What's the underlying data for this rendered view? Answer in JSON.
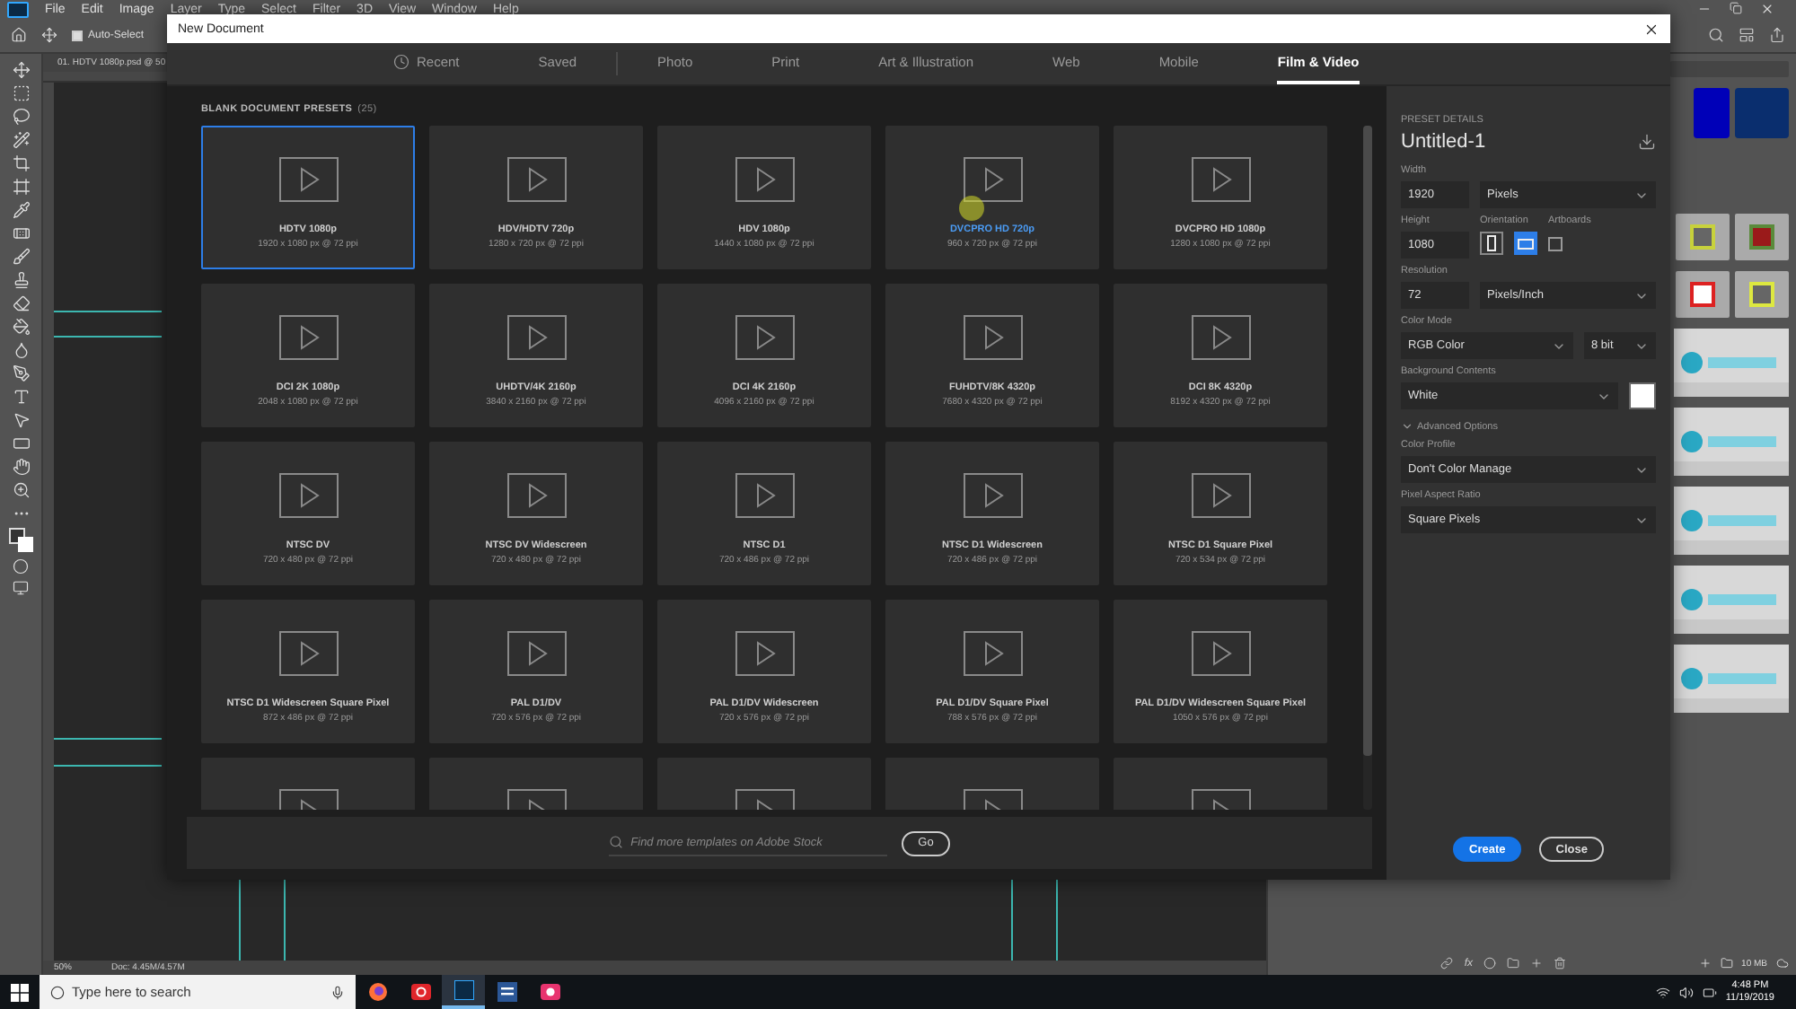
{
  "photoshop": {
    "menu": [
      "File",
      "Edit",
      "Image",
      "Layer",
      "Type",
      "Select",
      "Filter",
      "3D",
      "View",
      "Window",
      "Help"
    ],
    "options_bar": {
      "auto_select": {
        "label": "Auto-Select",
        "checked": true
      }
    },
    "document_tab": "01. HDTV 1080p.psd @ 50",
    "status_bar": {
      "zoom": "50%",
      "doc": "Doc: 4.45M/4.57M"
    },
    "layers_footer": {
      "fx": "fx"
    },
    "panel_footer": {
      "size": "10 MB"
    }
  },
  "dialog": {
    "title": "New Document",
    "tabs": [
      {
        "label": "Recent",
        "kind": "recent",
        "selected": false
      },
      {
        "label": "Saved",
        "kind": "saved",
        "selected": false
      },
      {
        "label": "Photo",
        "kind": "category",
        "selected": false
      },
      {
        "label": "Print",
        "kind": "category",
        "selected": false
      },
      {
        "label": "Art & Illustration",
        "kind": "category",
        "selected": false
      },
      {
        "label": "Web",
        "kind": "category",
        "selected": false
      },
      {
        "label": "Mobile",
        "kind": "category",
        "selected": false
      },
      {
        "label": "Film & Video",
        "kind": "category",
        "selected": true
      }
    ],
    "presets": {
      "heading": "BLANK DOCUMENT PRESETS",
      "count": "(25)",
      "items": [
        {
          "name": "HDTV 1080p",
          "size": "1920 x 1080 px @ 72 ppi",
          "selected": true,
          "hovered": false
        },
        {
          "name": "HDV/HDTV 720p",
          "size": "1280 x 720 px @ 72 ppi",
          "selected": false,
          "hovered": false
        },
        {
          "name": "HDV 1080p",
          "size": "1440 x 1080 px @ 72 ppi",
          "selected": false,
          "hovered": false
        },
        {
          "name": "DVCPRO HD 720p",
          "size": "960 x 720 px @ 72 ppi",
          "selected": false,
          "hovered": true
        },
        {
          "name": "DVCPRO HD 1080p",
          "size": "1280 x 1080 px @ 72 ppi",
          "selected": false,
          "hovered": false
        },
        {
          "name": "DCI 2K 1080p",
          "size": "2048 x 1080 px @ 72 ppi",
          "selected": false,
          "hovered": false
        },
        {
          "name": "UHDTV/4K 2160p",
          "size": "3840 x 2160 px @ 72 ppi",
          "selected": false,
          "hovered": false
        },
        {
          "name": "DCI 4K 2160p",
          "size": "4096 x 2160 px @ 72 ppi",
          "selected": false,
          "hovered": false
        },
        {
          "name": "FUHDTV/8K 4320p",
          "size": "7680 x 4320 px @ 72 ppi",
          "selected": false,
          "hovered": false
        },
        {
          "name": "DCI 8K 4320p",
          "size": "8192 x 4320 px @ 72 ppi",
          "selected": false,
          "hovered": false
        },
        {
          "name": "NTSC DV",
          "size": "720 x 480 px @ 72 ppi",
          "selected": false,
          "hovered": false
        },
        {
          "name": "NTSC DV Widescreen",
          "size": "720 x 480 px @ 72 ppi",
          "selected": false,
          "hovered": false
        },
        {
          "name": "NTSC D1",
          "size": "720 x 486 px @ 72 ppi",
          "selected": false,
          "hovered": false
        },
        {
          "name": "NTSC D1 Widescreen",
          "size": "720 x 486 px @ 72 ppi",
          "selected": false,
          "hovered": false
        },
        {
          "name": "NTSC D1 Square Pixel",
          "size": "720 x 534 px @ 72 ppi",
          "selected": false,
          "hovered": false
        },
        {
          "name": "NTSC D1 Widescreen Square Pixel",
          "size": "872 x 486 px @ 72 ppi",
          "selected": false,
          "hovered": false
        },
        {
          "name": "PAL D1/DV",
          "size": "720 x 576 px @ 72 ppi",
          "selected": false,
          "hovered": false
        },
        {
          "name": "PAL D1/DV Widescreen",
          "size": "720 x 576 px @ 72 ppi",
          "selected": false,
          "hovered": false
        },
        {
          "name": "PAL D1/DV Square Pixel",
          "size": "788 x 576 px @ 72 ppi",
          "selected": false,
          "hovered": false
        },
        {
          "name": "PAL D1/DV Widescreen Square Pixel",
          "size": "1050 x 576 px @ 72 ppi",
          "selected": false,
          "hovered": false
        }
      ]
    },
    "search": {
      "placeholder": "Find more templates on Adobe Stock",
      "button": "Go"
    },
    "details": {
      "heading": "PRESET DETAILS",
      "name": "Untitled-1",
      "width": {
        "label": "Width",
        "value": "1920",
        "unit": "Pixels"
      },
      "height": {
        "label": "Height",
        "value": "1080"
      },
      "orientation": {
        "label": "Orientation",
        "options": [
          {
            "kind": "portrait",
            "selected": false
          },
          {
            "kind": "landscape",
            "selected": true
          }
        ]
      },
      "artboards": {
        "label": "Artboards",
        "checked": false
      },
      "resolution": {
        "label": "Resolution",
        "value": "72",
        "unit": "Pixels/Inch"
      },
      "color_mode": {
        "label": "Color Mode",
        "mode": "RGB Color",
        "depth": "8 bit"
      },
      "background": {
        "label": "Background Contents",
        "value": "White",
        "color": "#ffffff"
      },
      "advanced": {
        "label": "Advanced Options",
        "expanded": true
      },
      "color_profile": {
        "label": "Color Profile",
        "value": "Don't Color Manage"
      },
      "pixel_aspect": {
        "label": "Pixel Aspect Ratio",
        "value": "Square Pixels"
      }
    },
    "buttons": [
      {
        "label": "Create",
        "kind": "primary"
      },
      {
        "label": "Close",
        "kind": "secondary"
      }
    ]
  },
  "taskbar": {
    "search_placeholder": "Type here to search",
    "time": "4:48 PM",
    "date": "11/19/2019"
  }
}
